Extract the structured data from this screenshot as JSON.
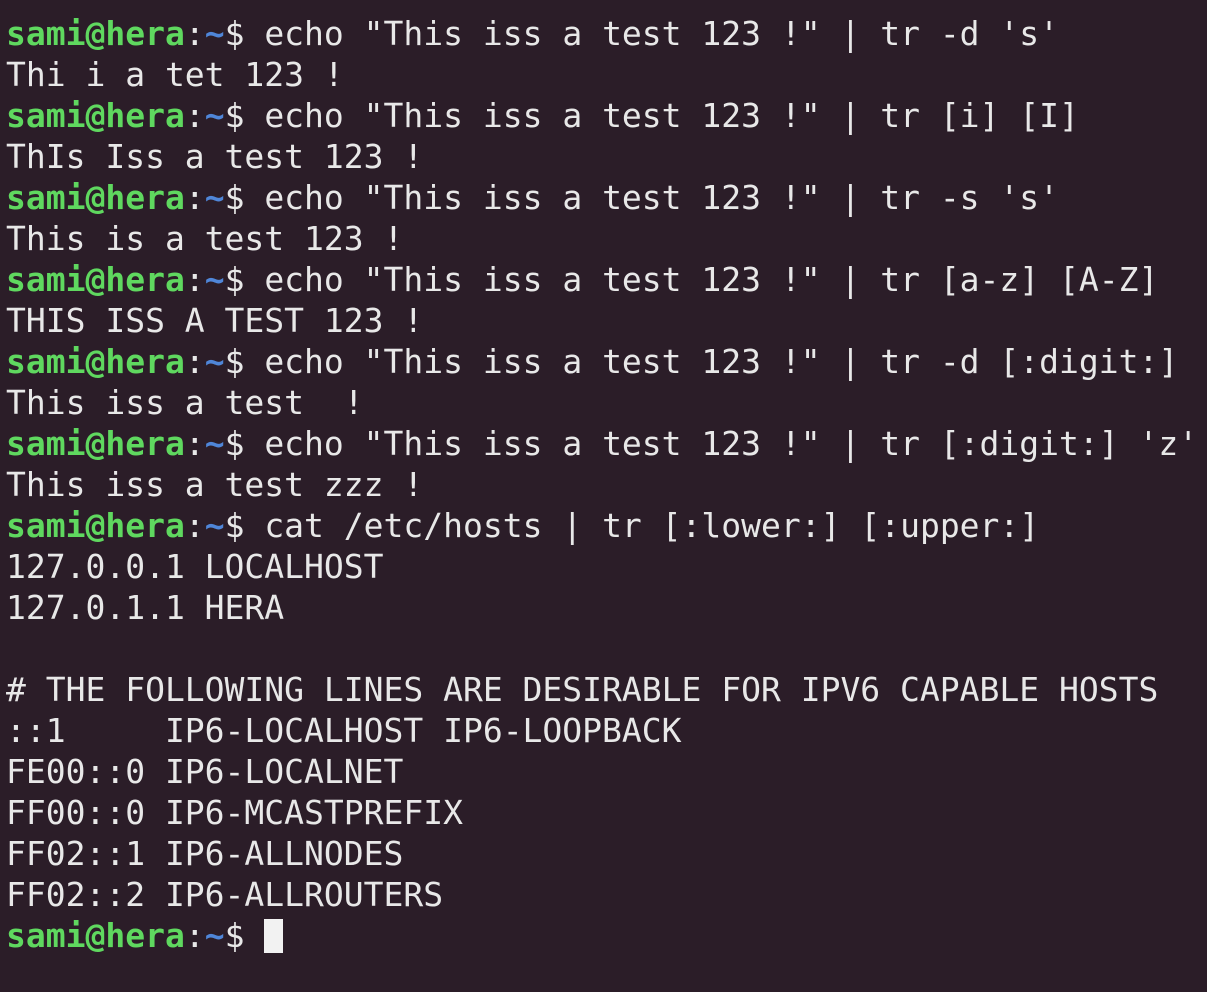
{
  "prompt": {
    "user_host": "sami@hera",
    "separator": ":",
    "path": "~",
    "symbol": "$ "
  },
  "lines": [
    {
      "type": "cmd",
      "text": "echo \"This iss a test 123 !\" | tr -d 's'"
    },
    {
      "type": "out",
      "text": "Thi i a tet 123 !"
    },
    {
      "type": "cmd",
      "text": "echo \"This iss a test 123 !\" | tr [i] [I]"
    },
    {
      "type": "out",
      "text": "ThIs Iss a test 123 !"
    },
    {
      "type": "cmd",
      "text": "echo \"This iss a test 123 !\" | tr -s 's'"
    },
    {
      "type": "out",
      "text": "This is a test 123 !"
    },
    {
      "type": "cmd",
      "text": "echo \"This iss a test 123 !\" | tr [a-z] [A-Z]"
    },
    {
      "type": "out",
      "text": "THIS ISS A TEST 123 !"
    },
    {
      "type": "cmd",
      "text": "echo \"This iss a test 123 !\" | tr -d [:digit:]"
    },
    {
      "type": "out",
      "text": "This iss a test  !"
    },
    {
      "type": "cmd",
      "text": "echo \"This iss a test 123 !\" | tr [:digit:] 'z'"
    },
    {
      "type": "out",
      "text": "This iss a test zzz !"
    },
    {
      "type": "cmd",
      "text": "cat /etc/hosts | tr [:lower:] [:upper:]"
    },
    {
      "type": "out",
      "text": "127.0.0.1 LOCALHOST"
    },
    {
      "type": "out",
      "text": "127.0.1.1 HERA"
    },
    {
      "type": "out",
      "text": ""
    },
    {
      "type": "out",
      "text": "# THE FOLLOWING LINES ARE DESIRABLE FOR IPV6 CAPABLE HOSTS"
    },
    {
      "type": "out",
      "text": "::1     IP6-LOCALHOST IP6-LOOPBACK"
    },
    {
      "type": "out",
      "text": "FE00::0 IP6-LOCALNET"
    },
    {
      "type": "out",
      "text": "FF00::0 IP6-MCASTPREFIX"
    },
    {
      "type": "out",
      "text": "FF02::1 IP6-ALLNODES"
    },
    {
      "type": "out",
      "text": "FF02::2 IP6-ALLROUTERS"
    },
    {
      "type": "cmd",
      "text": ""
    }
  ],
  "colors": {
    "background": "#2b1d28",
    "user_host": "#5fd85f",
    "path": "#4f86d8",
    "text": "#e8e8e8"
  }
}
